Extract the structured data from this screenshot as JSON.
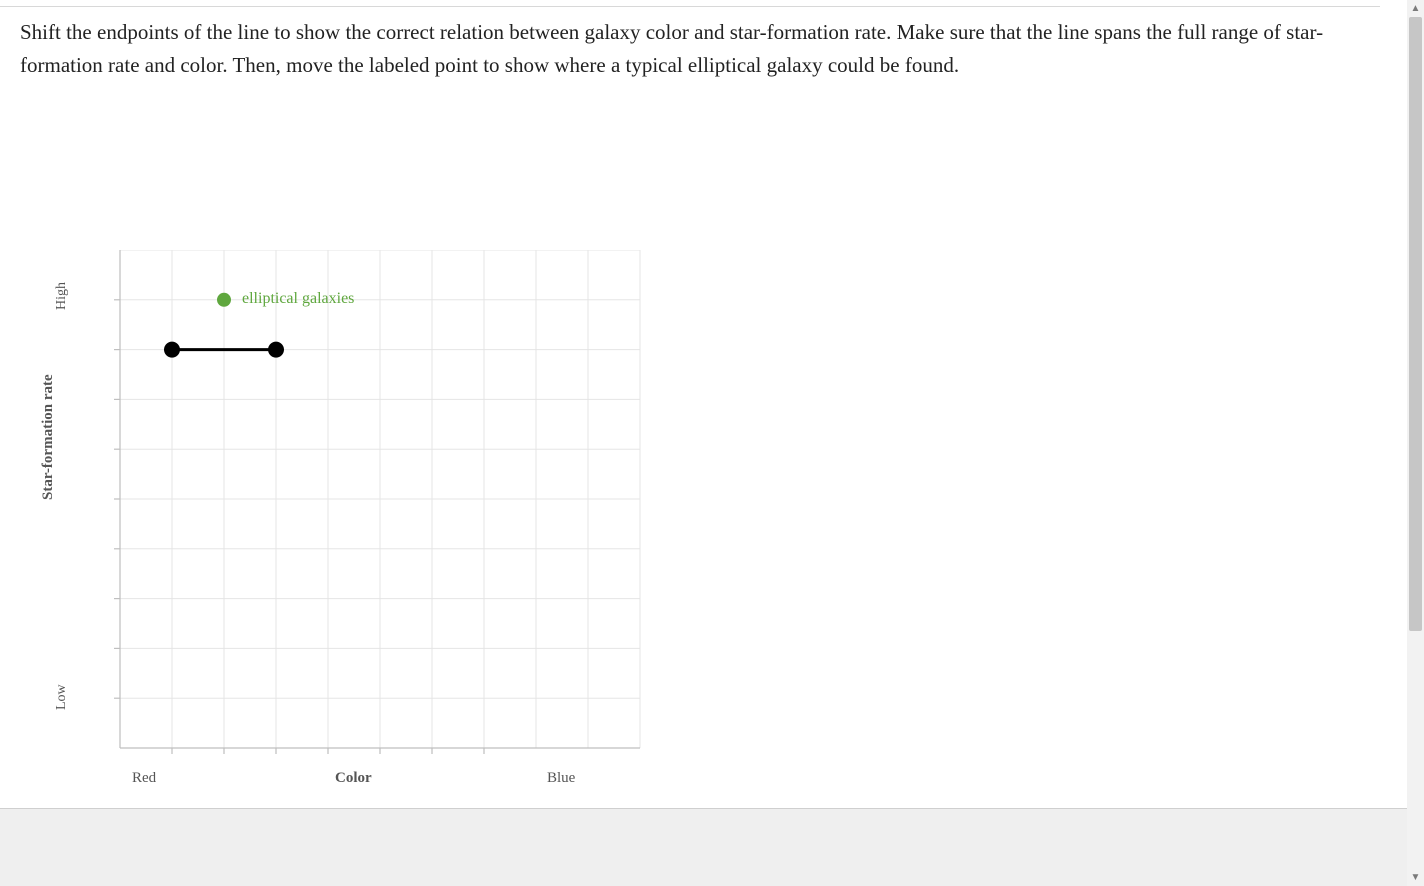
{
  "prompt_text": "Shift the endpoints of the line to show the correct relation between galaxy color and star-formation rate. Make sure that the line spans the full range of star-formation rate and color. Then, move the labeled point to show where a typical elliptical galaxy could be found.",
  "chart_data": {
    "type": "scatter",
    "title": "",
    "xlabel": "Color",
    "ylabel": "Star-formation rate",
    "x_ticks": {
      "left": "Red",
      "right": "Blue"
    },
    "y_ticks": {
      "low": "Low",
      "high": "High"
    },
    "xlim": [
      0,
      10
    ],
    "ylim": [
      0,
      10
    ],
    "grid": true,
    "series": [
      {
        "name": "relation-line",
        "kind": "draggable-line",
        "endpoints": [
          {
            "x": 1,
            "y": 8
          },
          {
            "x": 3,
            "y": 8
          }
        ]
      },
      {
        "name": "elliptical-point",
        "kind": "labeled-point",
        "label": "elliptical galaxies",
        "color": "#5fa73e",
        "point": {
          "x": 2,
          "y": 9
        }
      }
    ]
  }
}
